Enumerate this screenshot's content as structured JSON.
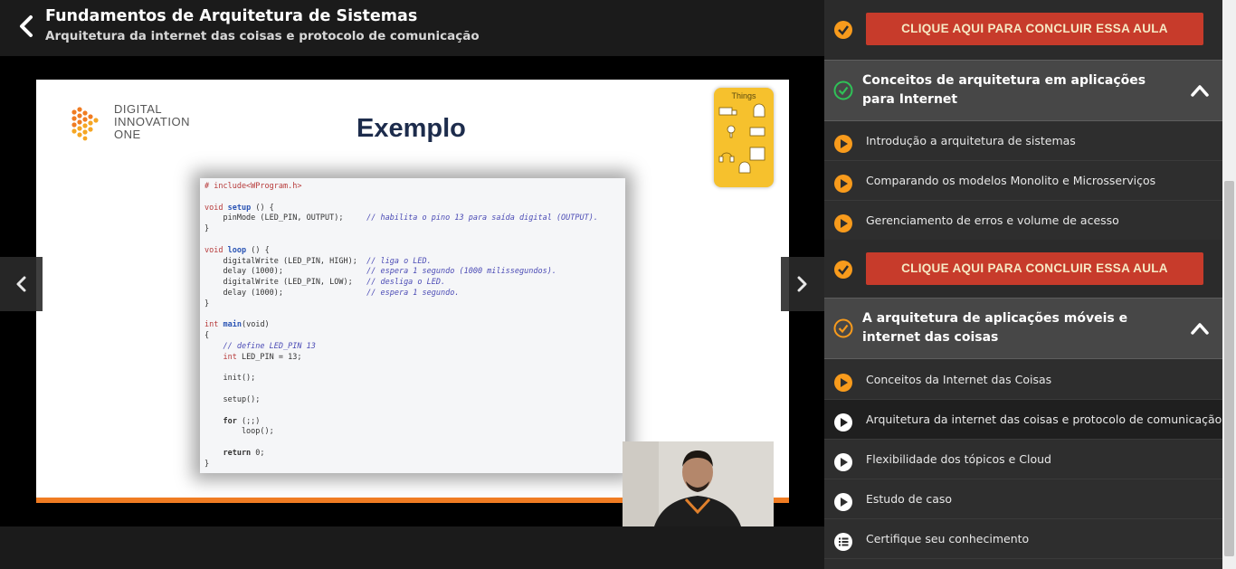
{
  "header": {
    "course_title": "Fundamentos de Arquitetura de Sistemas",
    "lesson_subtitle": "Arquitetura da internet das coisas e protocolo de comunicação"
  },
  "slide": {
    "logo_lines": [
      "DIGITAL",
      "INNOVATION",
      "ONE"
    ],
    "heading": "Exemplo",
    "things_label": "Things",
    "code_lines": {
      "l1": "# include<WProgram.h>",
      "l3a": "void",
      "l3b": "setup",
      "l3c": " () {",
      "l4a": "    pinMode (LED_PIN, OUTPUT);     ",
      "l4b": "// habilita o pino 13 para saída digital (OUTPUT).",
      "l5": "}",
      "l7a": "void",
      "l7b": "loop",
      "l7c": " () {",
      "l8a": "    digitalWrite (LED_PIN, HIGH);  ",
      "l8b": "// liga o LED.",
      "l9a": "    delay (1000);                  ",
      "l9b": "// espera 1 segundo (1000 milissegundos).",
      "l10a": "    digitalWrite (LED_PIN, LOW);   ",
      "l10b": "// desliga o LED.",
      "l11a": "    delay (1000);                  ",
      "l11b": "// espera 1 segundo.",
      "l12": "}",
      "l14a": "int",
      "l14b": "main",
      "l14c": "(void)",
      "l15": "{",
      "l16": "    // define LED_PIN 13",
      "l17a": "    int",
      "l17b": " LED_PIN = 13;",
      "l19": "    init();",
      "l21": "    setup();",
      "l23a": "    for",
      "l23b": " (;;)",
      "l24": "        loop();",
      "l26a": "    return",
      "l26b": " 0;",
      "l27": "}"
    }
  },
  "sidebar": {
    "complete_label": "CLIQUE AQUI PARA CONCLUIR ESSA AULA",
    "modules": [
      {
        "title": "Conceitos de arquitetura em aplicações para Internet",
        "lessons": [
          "Introdução a arquitetura de sistemas",
          "Comparando os modelos Monolito e Microsserviços",
          "Gerenciamento de erros e volume de acesso"
        ]
      },
      {
        "title": "A arquitetura de aplicações móveis e internet das coisas",
        "lessons": [
          "Conceitos da Internet das Coisas",
          "Arquitetura da internet das coisas e protocolo de comunicação",
          "Flexibilidade dos tópicos e Cloud",
          "Estudo de caso",
          "Certifique seu conhecimento"
        ]
      }
    ]
  },
  "colors": {
    "accent": "#f89b1c",
    "complete_button": "#c73b2b",
    "module_header": "#474747",
    "sidebar": "#2e2e2e"
  },
  "icons": {
    "back": "chevron-left-icon",
    "prev": "chevron-left-icon",
    "next": "chevron-right-icon",
    "done": "check-circle-icon",
    "play": "play-circle-icon",
    "quiz": "list-icon",
    "collapse": "chevron-up-icon"
  }
}
